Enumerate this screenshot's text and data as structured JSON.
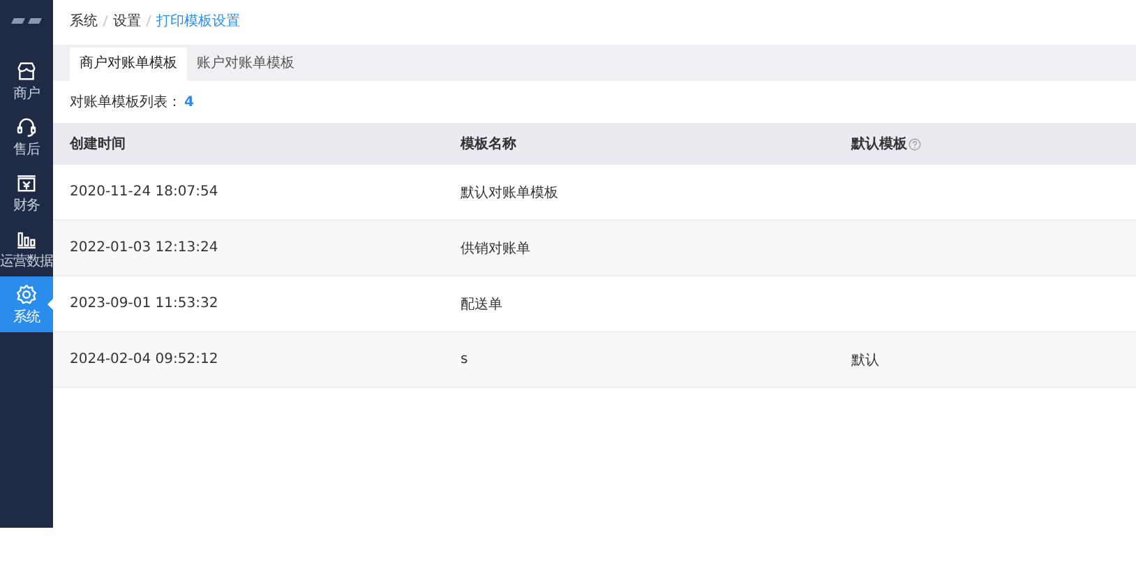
{
  "sidebar": {
    "items": [
      {
        "label": "商户",
        "kind": "store",
        "selected": false
      },
      {
        "label": "售后",
        "kind": "headset",
        "selected": false
      },
      {
        "label": "财务",
        "kind": "money",
        "selected": false
      },
      {
        "label": "运营数据",
        "kind": "chart",
        "selected": false
      },
      {
        "label": "系统",
        "kind": "gear",
        "selected": true
      }
    ]
  },
  "breadcrumb": [
    "系统",
    "设置",
    "打印模板设置"
  ],
  "tabs": [
    {
      "label": "商户对账单模板",
      "selected": true
    },
    {
      "label": "账户对账单模板",
      "selected": false
    }
  ],
  "list_summary": {
    "label": "对账单模板列表：",
    "count": "4"
  },
  "table": {
    "columns": [
      "创建时间",
      "模板名称",
      "默认模板"
    ],
    "rows": [
      [
        "2020-11-24 18:07:54",
        "默认对账单模板",
        ""
      ],
      [
        "2022-01-03 12:13:24",
        "供销对账单",
        ""
      ],
      [
        "2023-09-01 11:53:32",
        "配送单",
        ""
      ],
      [
        "2024-02-04 09:52:12",
        "s",
        "默认"
      ]
    ]
  }
}
